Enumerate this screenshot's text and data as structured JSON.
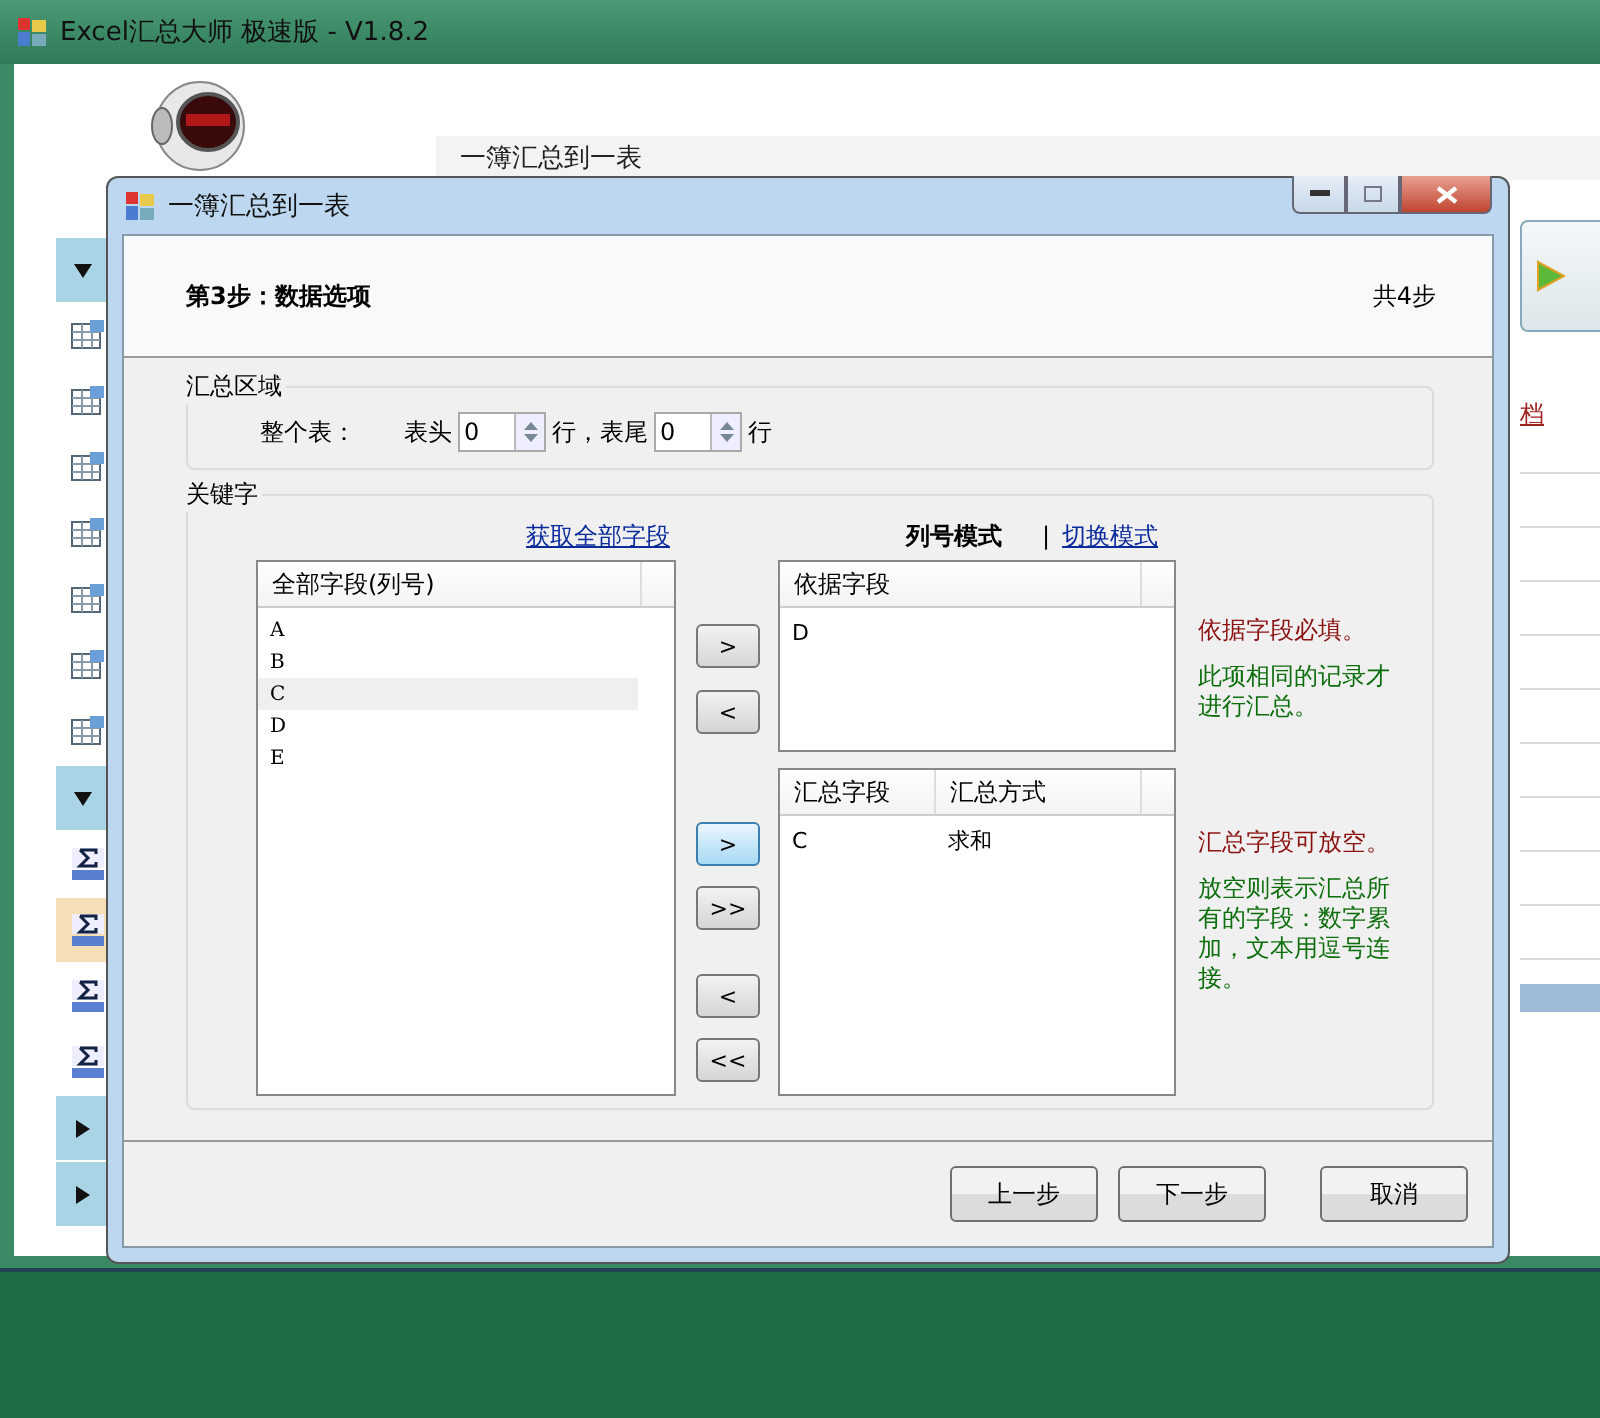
{
  "app_window": {
    "title": "Excel汇总大师 极速版 - V1.8.2",
    "page_heading": "一簿汇总到一表",
    "right_link": "档"
  },
  "sidebar": {
    "groups": [
      {
        "expanded": true,
        "items": [
          {
            "kind": "table",
            "selected": false
          },
          {
            "kind": "table",
            "selected": false
          },
          {
            "kind": "table",
            "selected": false
          },
          {
            "kind": "table",
            "selected": false
          },
          {
            "kind": "table",
            "selected": false
          },
          {
            "kind": "table",
            "selected": false
          },
          {
            "kind": "table",
            "selected": false
          }
        ]
      },
      {
        "expanded": true,
        "items": [
          {
            "kind": "sum",
            "selected": false
          },
          {
            "kind": "sum",
            "selected": true
          },
          {
            "kind": "sum",
            "selected": false
          },
          {
            "kind": "sum",
            "selected": false
          }
        ]
      },
      {
        "expanded": false
      },
      {
        "expanded": false
      }
    ]
  },
  "dialog": {
    "title": "一簿汇总到一表",
    "step_title": "第3步：数据选项",
    "step_count": "共4步",
    "range_group": {
      "label": "汇总区域",
      "whole_table_label": "整个表：",
      "header_label": "表头",
      "header_rows": "0",
      "unit_1": "行，表尾",
      "footer_rows": "0",
      "unit_2": "行"
    },
    "key_group": {
      "label": "关键字",
      "fetch_link": "获取全部字段",
      "mode_label": "列号模式",
      "separator": "|",
      "switch_link": "切换模式",
      "all_fields": {
        "column": "全部字段(列号)",
        "items": [
          {
            "text": "A",
            "selected": false
          },
          {
            "text": "B",
            "selected": false
          },
          {
            "text": "C",
            "selected": true
          },
          {
            "text": "D",
            "selected": false
          },
          {
            "text": "E",
            "selected": false
          }
        ]
      },
      "transfer_buttons": [
        {
          "label": ">",
          "hovered": false
        },
        {
          "label": "<",
          "hovered": false
        },
        {
          "label": ">",
          "hovered": true
        },
        {
          "label": ">>",
          "hovered": false
        },
        {
          "label": "<",
          "hovered": false
        },
        {
          "label": "<<",
          "hovered": false
        }
      ],
      "basis_fields": {
        "columns": [
          "依据字段"
        ],
        "rows": [
          [
            "D"
          ]
        ]
      },
      "summary_fields": {
        "columns": [
          "汇总字段",
          "汇总方式"
        ],
        "rows": [
          [
            "C",
            "求和"
          ]
        ]
      },
      "basis_notes": [
        {
          "kind": "warning",
          "text": "依据字段必填。"
        },
        {
          "kind": "info",
          "text": "此项相同的记录才进行汇总。"
        }
      ],
      "summary_notes": [
        {
          "kind": "warning",
          "text": "汇总字段可放空。"
        },
        {
          "kind": "info",
          "text": "放空则表示汇总所有的字段：数字累加，文本用逗号连接。"
        }
      ]
    },
    "buttons": [
      "上一步",
      "下一步",
      "取消"
    ]
  }
}
